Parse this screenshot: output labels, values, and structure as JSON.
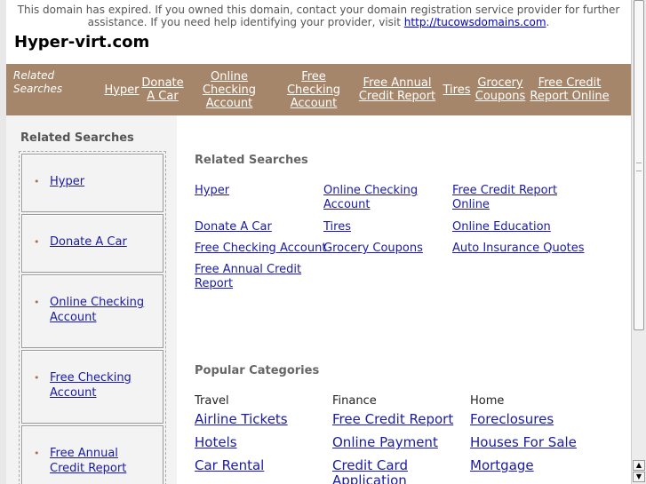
{
  "notice": {
    "line1": "This domain has expired. If you owned this domain, contact your domain registration service provider for further",
    "line2": "assistance. If you need help identifying your provider, visit ",
    "link": "http://tucowsdomains.com",
    "period": "."
  },
  "site_title": "Hyper-virt.com",
  "topbar": {
    "label_line1": "Related",
    "label_line2": "Searches",
    "links": [
      "Hyper",
      "Donate A Car",
      "Online Checking Account",
      "Free Checking Account",
      "Free Annual Credit Report",
      "Tires",
      "Grocery Coupons",
      "Free Credit Report Online"
    ]
  },
  "sidebar": {
    "title": "Related Searches",
    "items": [
      "Hyper",
      "Donate A Car",
      "Online Checking Account",
      "Free Checking Account",
      "Free Annual Credit Report"
    ],
    "bullet": "•"
  },
  "main": {
    "related_title": "Related Searches",
    "related_links": [
      "Hyper",
      "Online Checking Account",
      "Free Credit Report Online",
      "Donate A Car",
      "Tires",
      "Online Education",
      "Free Checking Account",
      "Grocery Coupons",
      "Auto Insurance Quotes",
      "Free Annual Credit Report"
    ],
    "popular_title": "Popular Categories",
    "categories": [
      {
        "head": "Travel",
        "links": [
          "Airline Tickets",
          "Hotels",
          "Car Rental"
        ]
      },
      {
        "head": "Finance",
        "links": [
          "Free Credit Report",
          "Online Payment",
          "Credit Card Application"
        ]
      },
      {
        "head": "Home",
        "links": [
          "Foreclosures",
          "Houses For Sale",
          "Mortgage"
        ]
      }
    ]
  },
  "scrollbar": {
    "up": "▲",
    "down": "▼"
  }
}
